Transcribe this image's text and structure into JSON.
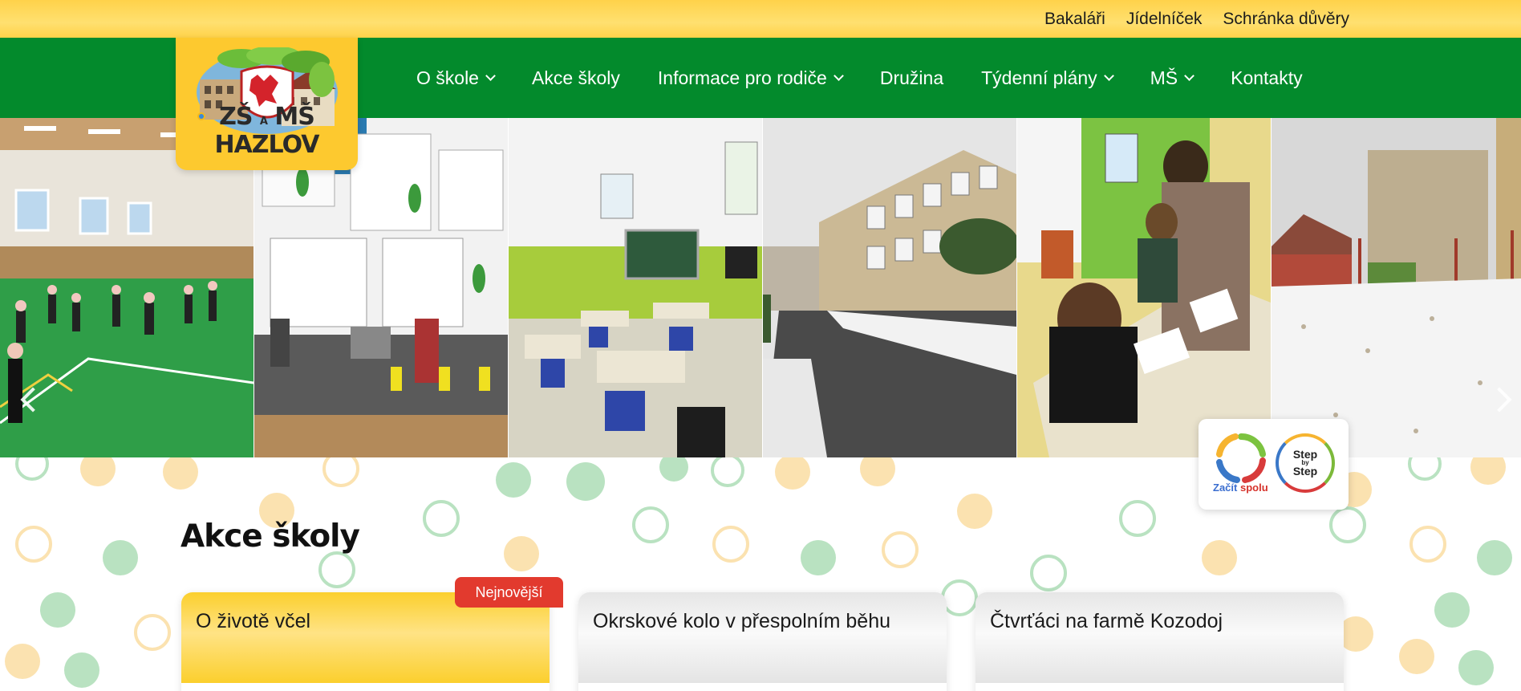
{
  "topbar": {
    "links": [
      "Bakaláři",
      "Jídelníček",
      "Schránka důvěry"
    ]
  },
  "nav": {
    "items": [
      {
        "label": "O škole",
        "dropdown": true
      },
      {
        "label": "Akce školy",
        "dropdown": false
      },
      {
        "label": "Informace pro rodiče",
        "dropdown": true
      },
      {
        "label": "Družina",
        "dropdown": false
      },
      {
        "label": "Týdenní plány",
        "dropdown": true
      },
      {
        "label": "MŠ",
        "dropdown": true
      },
      {
        "label": "Kontakty",
        "dropdown": false
      }
    ]
  },
  "logo": {
    "text_main": "ZŠ",
    "text_a": "A",
    "text_rest": "MŠ HAZLOV"
  },
  "slider": {
    "slides": [
      "gym-dance",
      "project-exhibition",
      "classroom",
      "school-building",
      "students-working",
      "snowy-playground"
    ]
  },
  "partner": {
    "zacit_1": "Začít",
    "zacit_2": "spolu",
    "sbs_1": "Step",
    "sbs_by": "by",
    "sbs_2": "Step"
  },
  "section": {
    "title": "Akce školy",
    "new_label": "Nejnovější",
    "cards": [
      {
        "title": "O životě včel"
      },
      {
        "title": "Okrskové kolo v přespolním běhu"
      },
      {
        "title": "Čtvrťáci na farmě Kozodoj"
      }
    ]
  },
  "colors": {
    "yellow": "#fdc92f",
    "green": "#038a2c",
    "red_badge": "#e23a2e"
  }
}
